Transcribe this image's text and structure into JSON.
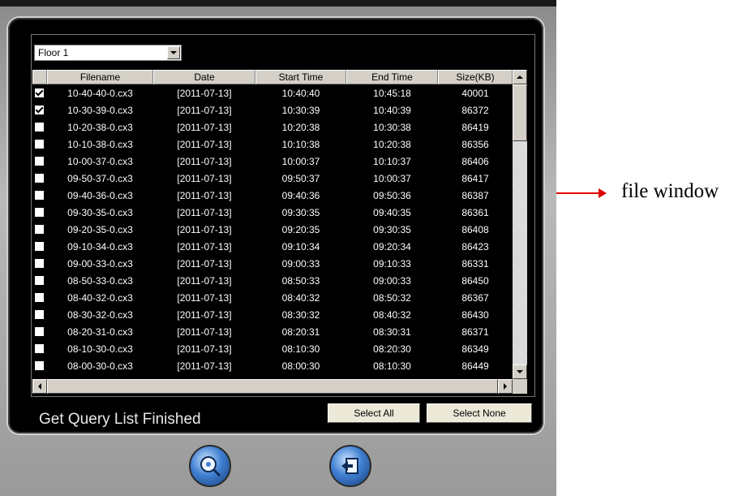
{
  "floor_select": {
    "value": "Floor 1"
  },
  "columns": [
    "Filename",
    "Date",
    "Start Time",
    "End Time",
    "Size(KB)"
  ],
  "rows": [
    {
      "checked": true,
      "filename": "10-40-40-0.cx3",
      "date": "[2011-07-13]",
      "start": "10:40:40",
      "end": "10:45:18",
      "size": "40001"
    },
    {
      "checked": true,
      "filename": "10-30-39-0.cx3",
      "date": "[2011-07-13]",
      "start": "10:30:39",
      "end": "10:40:39",
      "size": "86372"
    },
    {
      "checked": false,
      "filename": "10-20-38-0.cx3",
      "date": "[2011-07-13]",
      "start": "10:20:38",
      "end": "10:30:38",
      "size": "86419"
    },
    {
      "checked": false,
      "filename": "10-10-38-0.cx3",
      "date": "[2011-07-13]",
      "start": "10:10:38",
      "end": "10:20:38",
      "size": "86356"
    },
    {
      "checked": false,
      "filename": "10-00-37-0.cx3",
      "date": "[2011-07-13]",
      "start": "10:00:37",
      "end": "10:10:37",
      "size": "86406"
    },
    {
      "checked": false,
      "filename": "09-50-37-0.cx3",
      "date": "[2011-07-13]",
      "start": "09:50:37",
      "end": "10:00:37",
      "size": "86417"
    },
    {
      "checked": false,
      "filename": "09-40-36-0.cx3",
      "date": "[2011-07-13]",
      "start": "09:40:36",
      "end": "09:50:36",
      "size": "86387"
    },
    {
      "checked": false,
      "filename": "09-30-35-0.cx3",
      "date": "[2011-07-13]",
      "start": "09:30:35",
      "end": "09:40:35",
      "size": "86361"
    },
    {
      "checked": false,
      "filename": "09-20-35-0.cx3",
      "date": "[2011-07-13]",
      "start": "09:20:35",
      "end": "09:30:35",
      "size": "86408"
    },
    {
      "checked": false,
      "filename": "09-10-34-0.cx3",
      "date": "[2011-07-13]",
      "start": "09:10:34",
      "end": "09:20:34",
      "size": "86423"
    },
    {
      "checked": false,
      "filename": "09-00-33-0.cx3",
      "date": "[2011-07-13]",
      "start": "09:00:33",
      "end": "09:10:33",
      "size": "86331"
    },
    {
      "checked": false,
      "filename": "08-50-33-0.cx3",
      "date": "[2011-07-13]",
      "start": "08:50:33",
      "end": "09:00:33",
      "size": "86450"
    },
    {
      "checked": false,
      "filename": "08-40-32-0.cx3",
      "date": "[2011-07-13]",
      "start": "08:40:32",
      "end": "08:50:32",
      "size": "86367"
    },
    {
      "checked": false,
      "filename": "08-30-32-0.cx3",
      "date": "[2011-07-13]",
      "start": "08:30:32",
      "end": "08:40:32",
      "size": "86430"
    },
    {
      "checked": false,
      "filename": "08-20-31-0.cx3",
      "date": "[2011-07-13]",
      "start": "08:20:31",
      "end": "08:30:31",
      "size": "86371"
    },
    {
      "checked": false,
      "filename": "08-10-30-0.cx3",
      "date": "[2011-07-13]",
      "start": "08:10:30",
      "end": "08:20:30",
      "size": "86349"
    },
    {
      "checked": false,
      "filename": "08-00-30-0.cx3",
      "date": "[2011-07-13]",
      "start": "08:00:30",
      "end": "08:10:30",
      "size": "86449"
    }
  ],
  "status": "Get Query List Finished",
  "buttons": {
    "select_all": "Select All",
    "select_none": "Select None"
  },
  "annotation": "file window",
  "colors": {
    "arrow": "#e00000",
    "panel": "#000000"
  }
}
